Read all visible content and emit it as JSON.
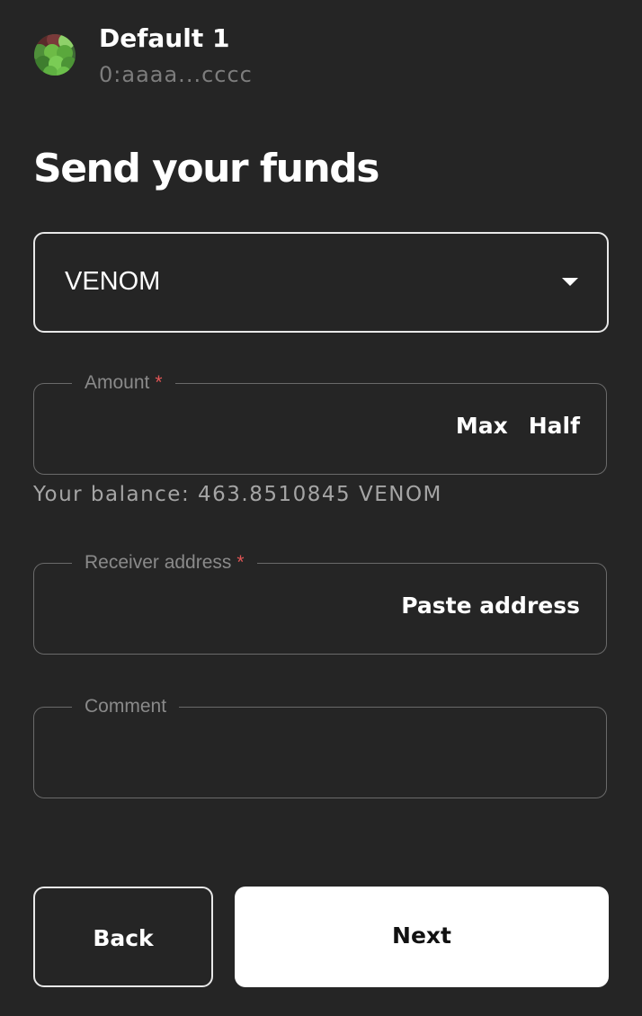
{
  "account": {
    "name": "Default 1",
    "address": "0:aaaa...cccc"
  },
  "page": {
    "title": "Send your funds"
  },
  "token_select": {
    "value": "VENOM"
  },
  "amount_field": {
    "label": "Amount",
    "required_mark": "*",
    "value": "",
    "max_label": "Max",
    "half_label": "Half"
  },
  "balance": {
    "text": "Your balance: 463.8510845 VENOM"
  },
  "receiver_field": {
    "label": "Receiver address",
    "required_mark": "*",
    "value": "",
    "paste_label": "Paste address"
  },
  "comment_field": {
    "label": "Comment",
    "value": ""
  },
  "buttons": {
    "back_label": "Back",
    "next_label": "Next"
  },
  "icons": {
    "avatar": "account-avatar",
    "select_caret": "caret-down-icon"
  },
  "colors": {
    "background": "#252525",
    "text_primary": "#ffffff",
    "text_muted": "#7d7d7d",
    "border": "#6a6a6a",
    "required": "#e05555",
    "primary_button": "#ffffff"
  }
}
